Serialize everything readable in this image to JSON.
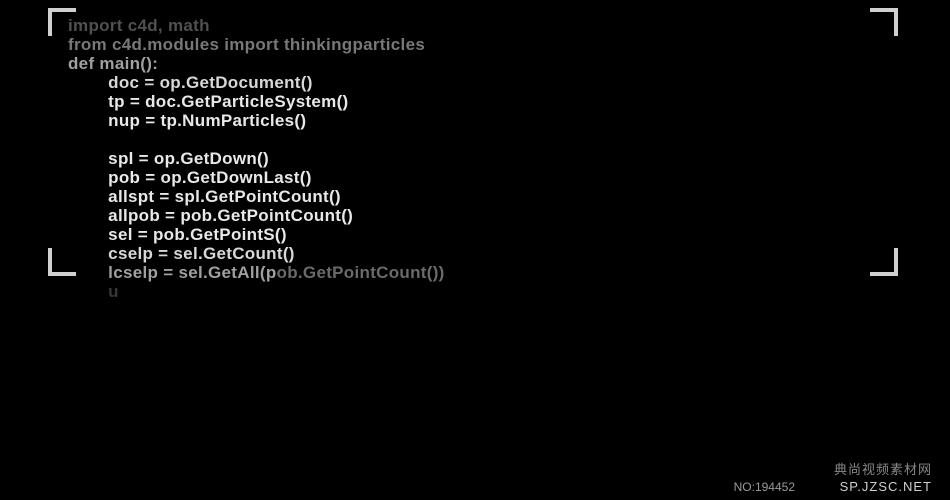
{
  "code": {
    "lines": [
      {
        "text": "import c4d, math",
        "cls": "line-faded1",
        "indent": 0
      },
      {
        "text": "from c4d.modules import thinkingparticles",
        "cls": "line-faded2",
        "indent": 0
      },
      {
        "text": "def main():",
        "cls": "line-faded3",
        "indent": 0
      },
      {
        "text": "doc = op.GetDocument()",
        "cls": "line-normal",
        "indent": 1
      },
      {
        "text": "tp = doc.GetParticleSystem()",
        "cls": "line-bright",
        "indent": 1
      },
      {
        "text": "nup = tp.NumParticles()",
        "cls": "line-bright",
        "indent": 1
      },
      {
        "text": "",
        "cls": "line-bright",
        "indent": 1
      },
      {
        "text": "spl = op.GetDown()",
        "cls": "line-bright",
        "indent": 1
      },
      {
        "text": "pob = op.GetDownLast()",
        "cls": "line-bright",
        "indent": 1
      },
      {
        "text": "allspt = spl.GetPointCount()",
        "cls": "line-bright",
        "indent": 1
      },
      {
        "text": "allpob = pob.GetPointCount()",
        "cls": "line-bright",
        "indent": 1
      },
      {
        "text": "sel = pob.GetPointS()",
        "cls": "line-bright",
        "indent": 1
      },
      {
        "text": "cselp = sel.GetCount()",
        "cls": "line-normal",
        "indent": 1
      },
      {
        "text": "lcselp = sel.GetAll(p",
        "cls": "line-faded3",
        "indent": 1,
        "suffix": "ob.GetPointCount())",
        "suffixCls": "faded-arg"
      },
      {
        "text": "u",
        "cls": "line-vfade",
        "indent": 1
      }
    ]
  },
  "watermark": {
    "cn": "典尚视频素材网",
    "url": "SP.JZSC.NET",
    "id": "NO:194452"
  }
}
